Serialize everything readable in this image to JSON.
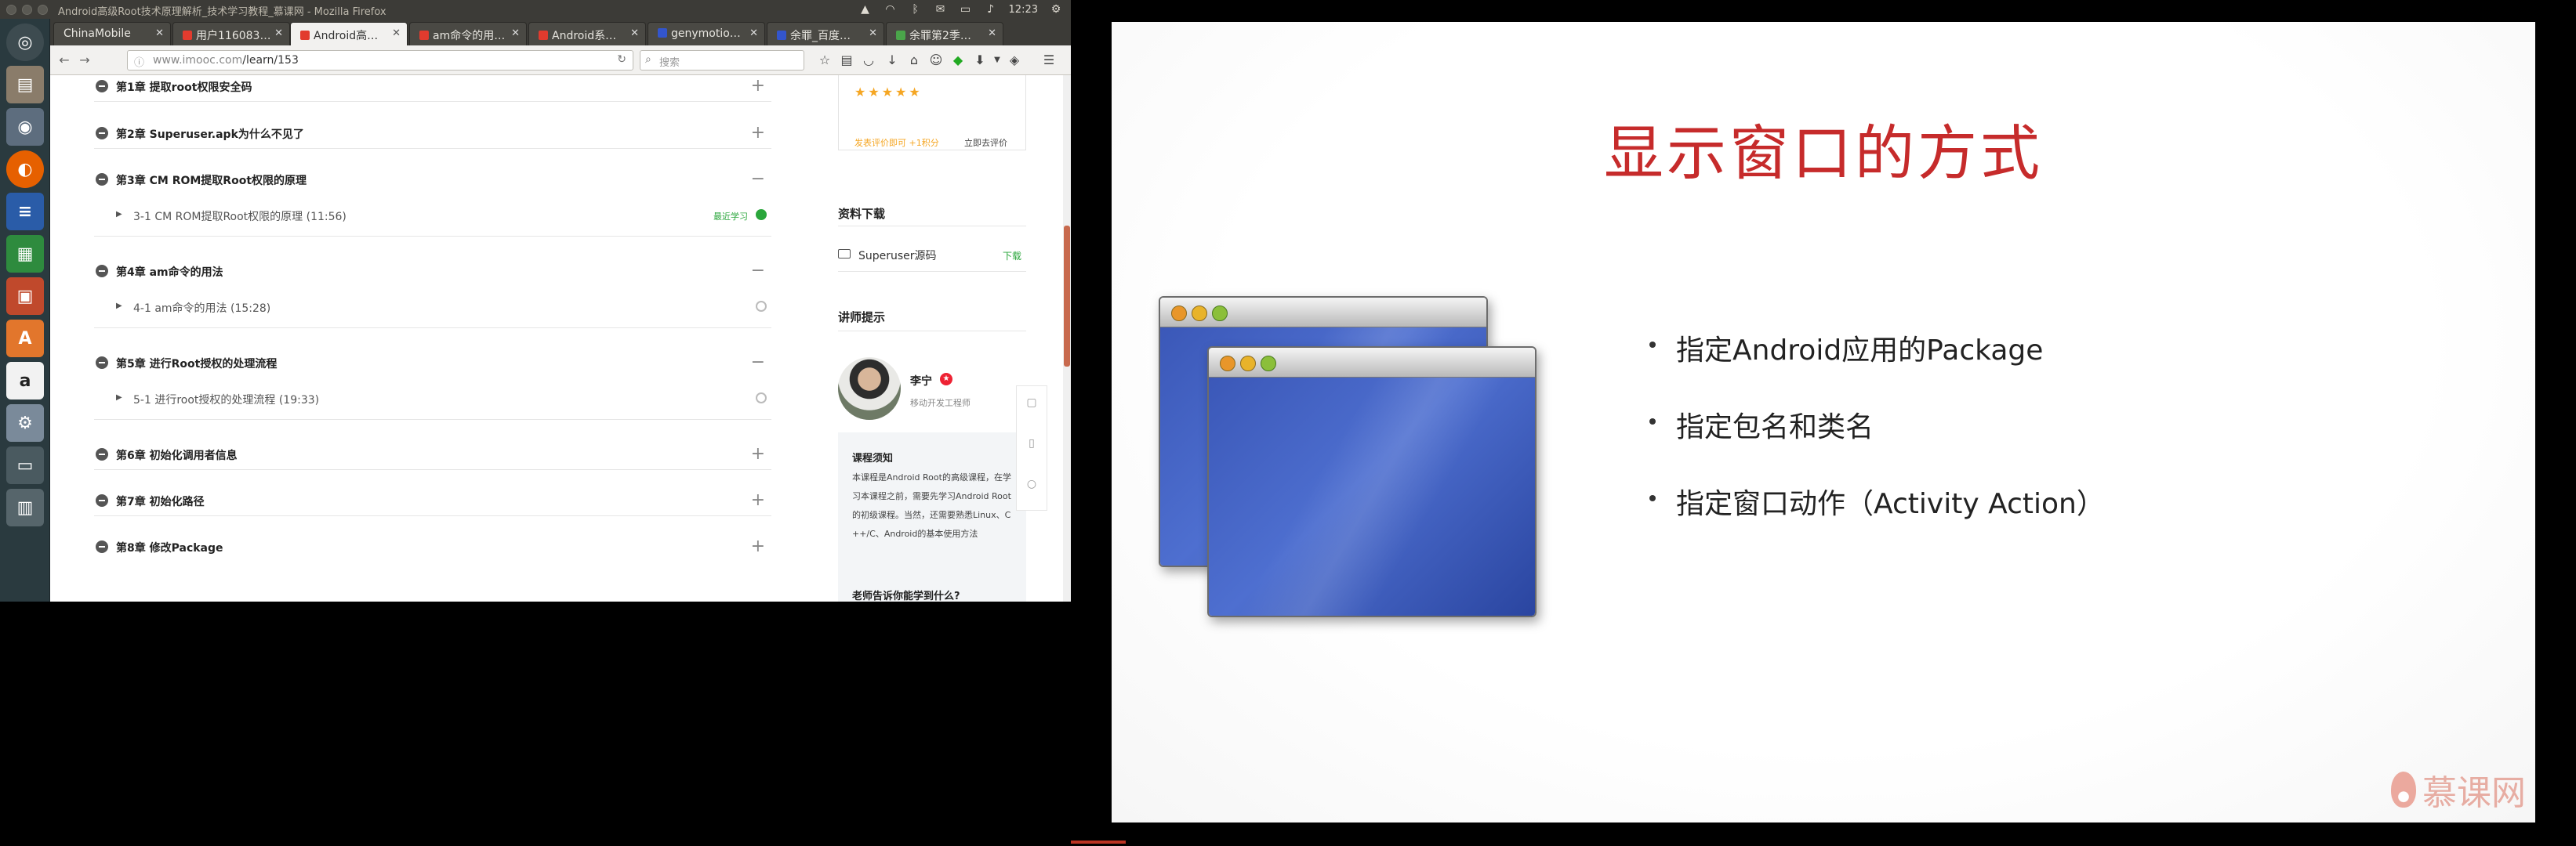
{
  "topbar": {
    "window_title": "Android高级Root技术原理解析_技术学习教程_慕课网 - Mozilla Firefox",
    "clock": "12:23"
  },
  "tabs": [
    {
      "label": "ChinaMobile",
      "active": false,
      "fav_color": "#3c3b37"
    },
    {
      "label": "用户116083…",
      "active": false,
      "fav_color": "#e23b2e"
    },
    {
      "label": "Android高…",
      "active": true,
      "fav_color": "#e23b2e"
    },
    {
      "label": "am命令的用…",
      "active": false,
      "fav_color": "#e23b2e"
    },
    {
      "label": "Android系…",
      "active": false,
      "fav_color": "#e23b2e"
    },
    {
      "label": "genymotio…",
      "active": false,
      "fav_color": "#3355cc"
    },
    {
      "label": "余罪_百度…",
      "active": false,
      "fav_color": "#3355cc"
    },
    {
      "label": "余罪第2季…",
      "active": false,
      "fav_color": "#4aa54a"
    }
  ],
  "nav": {
    "url_host": "www.imooc.com",
    "url_path": "/learn/153",
    "search_placeholder": "搜索"
  },
  "chapters": [
    {
      "title": "第1章 提取root权限安全码",
      "toggle": "+",
      "lessons": []
    },
    {
      "title": "第2章 Superuser.apk为什么不见了",
      "toggle": "+",
      "lessons": []
    },
    {
      "title": "第3章 CM ROM提取Root权限的原理",
      "toggle": "−",
      "lessons": [
        {
          "title": "3-1 CM ROM提取Root权限的原理 (11:56)",
          "recent": "最近学习",
          "current": true
        }
      ]
    },
    {
      "title": "第4章 am命令的用法",
      "toggle": "−",
      "lessons": [
        {
          "title": "4-1 am命令的用法 (15:28)",
          "recent": "",
          "current": false
        }
      ]
    },
    {
      "title": "第5章 进行Root授权的处理流程",
      "toggle": "−",
      "lessons": [
        {
          "title": "5-1 进行root授权的处理流程 (19:33)",
          "recent": "",
          "current": false
        }
      ]
    },
    {
      "title": "第6章 初始化调用者信息",
      "toggle": "+",
      "lessons": []
    },
    {
      "title": "第7章 初始化路径",
      "toggle": "+",
      "lessons": []
    },
    {
      "title": "第8章 修改Package",
      "toggle": "+",
      "lessons": []
    }
  ],
  "sidebar": {
    "stars": "★★★★★",
    "rate_earn": "发表评价即可 +1积分",
    "rate_go": "立即去评价",
    "download_head": "资料下载",
    "download_name": "Superuser源码",
    "download_btn": "下载",
    "teacher_head": "讲师提示",
    "teacher_name": "李宁",
    "teacher_badge": "★",
    "teacher_title": "移动开发工程师",
    "notice_head": "课程须知",
    "notice_text": "本课程是Android Root的高级课程，在学习本课程之前，需要先学习Android Root的初级课程。当然，还需要熟悉Linux、C++/C、Android的基本使用方法",
    "notice_head2": "老师告诉你能学到什么?"
  },
  "slide": {
    "title": "显示窗口的方式",
    "bullets": [
      "指定Android应用的Package",
      "指定包名和类名",
      "指定窗口动作（Activity Action）"
    ],
    "logo_text": "慕课网"
  },
  "icons": {
    "launcher": [
      "ubuntu-dash-icon",
      "files-icon",
      "dvd-icon",
      "firefox-icon",
      "writer-icon",
      "calc-icon",
      "impress-icon",
      "software-center-icon",
      "amazon-icon",
      "system-settings-icon",
      "workspace-icon"
    ]
  },
  "colors": {
    "accent_green": "#2aa63b",
    "slide_title": "#c62b2b",
    "star": "#f5a623"
  }
}
